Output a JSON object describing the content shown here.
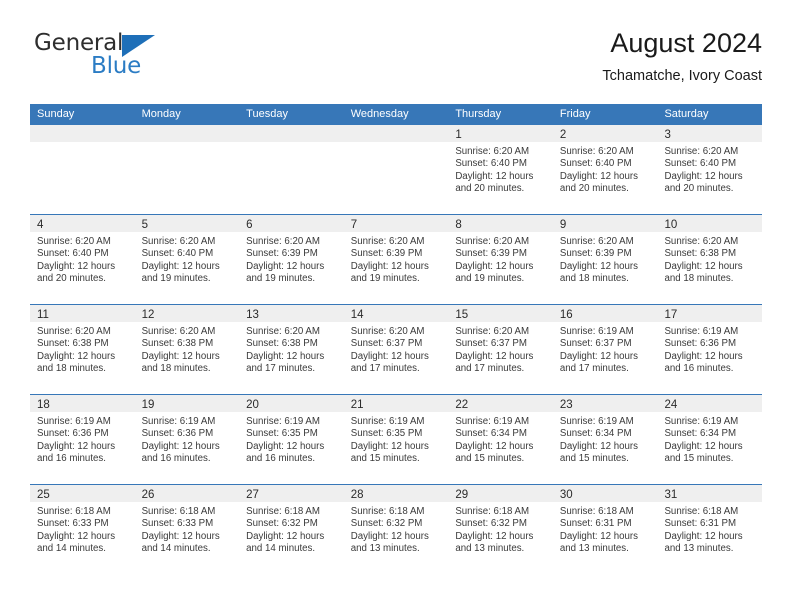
{
  "brand": {
    "name_part1": "General",
    "name_part2": "Blue",
    "triangle_icon": "triangle-icon",
    "accent_color": "#2b7cc4",
    "header_color": "#3777b8"
  },
  "header": {
    "title": "August 2024",
    "subtitle": "Tchamatche, Ivory Coast"
  },
  "weekdays": [
    "Sunday",
    "Monday",
    "Tuesday",
    "Wednesday",
    "Thursday",
    "Friday",
    "Saturday"
  ],
  "weeks": [
    [
      {
        "date": "",
        "empty": true,
        "sunrise": "",
        "sunset": "",
        "daylight_line1": "",
        "daylight_line2": ""
      },
      {
        "date": "",
        "empty": true,
        "sunrise": "",
        "sunset": "",
        "daylight_line1": "",
        "daylight_line2": ""
      },
      {
        "date": "",
        "empty": true,
        "sunrise": "",
        "sunset": "",
        "daylight_line1": "",
        "daylight_line2": ""
      },
      {
        "date": "",
        "empty": true,
        "sunrise": "",
        "sunset": "",
        "daylight_line1": "",
        "daylight_line2": ""
      },
      {
        "date": "1",
        "empty": false,
        "sunrise": "Sunrise: 6:20 AM",
        "sunset": "Sunset: 6:40 PM",
        "daylight_line1": "Daylight: 12 hours",
        "daylight_line2": "and 20 minutes."
      },
      {
        "date": "2",
        "empty": false,
        "sunrise": "Sunrise: 6:20 AM",
        "sunset": "Sunset: 6:40 PM",
        "daylight_line1": "Daylight: 12 hours",
        "daylight_line2": "and 20 minutes."
      },
      {
        "date": "3",
        "empty": false,
        "sunrise": "Sunrise: 6:20 AM",
        "sunset": "Sunset: 6:40 PM",
        "daylight_line1": "Daylight: 12 hours",
        "daylight_line2": "and 20 minutes."
      }
    ],
    [
      {
        "date": "4",
        "empty": false,
        "sunrise": "Sunrise: 6:20 AM",
        "sunset": "Sunset: 6:40 PM",
        "daylight_line1": "Daylight: 12 hours",
        "daylight_line2": "and 20 minutes."
      },
      {
        "date": "5",
        "empty": false,
        "sunrise": "Sunrise: 6:20 AM",
        "sunset": "Sunset: 6:40 PM",
        "daylight_line1": "Daylight: 12 hours",
        "daylight_line2": "and 19 minutes."
      },
      {
        "date": "6",
        "empty": false,
        "sunrise": "Sunrise: 6:20 AM",
        "sunset": "Sunset: 6:39 PM",
        "daylight_line1": "Daylight: 12 hours",
        "daylight_line2": "and 19 minutes."
      },
      {
        "date": "7",
        "empty": false,
        "sunrise": "Sunrise: 6:20 AM",
        "sunset": "Sunset: 6:39 PM",
        "daylight_line1": "Daylight: 12 hours",
        "daylight_line2": "and 19 minutes."
      },
      {
        "date": "8",
        "empty": false,
        "sunrise": "Sunrise: 6:20 AM",
        "sunset": "Sunset: 6:39 PM",
        "daylight_line1": "Daylight: 12 hours",
        "daylight_line2": "and 19 minutes."
      },
      {
        "date": "9",
        "empty": false,
        "sunrise": "Sunrise: 6:20 AM",
        "sunset": "Sunset: 6:39 PM",
        "daylight_line1": "Daylight: 12 hours",
        "daylight_line2": "and 18 minutes."
      },
      {
        "date": "10",
        "empty": false,
        "sunrise": "Sunrise: 6:20 AM",
        "sunset": "Sunset: 6:38 PM",
        "daylight_line1": "Daylight: 12 hours",
        "daylight_line2": "and 18 minutes."
      }
    ],
    [
      {
        "date": "11",
        "empty": false,
        "sunrise": "Sunrise: 6:20 AM",
        "sunset": "Sunset: 6:38 PM",
        "daylight_line1": "Daylight: 12 hours",
        "daylight_line2": "and 18 minutes."
      },
      {
        "date": "12",
        "empty": false,
        "sunrise": "Sunrise: 6:20 AM",
        "sunset": "Sunset: 6:38 PM",
        "daylight_line1": "Daylight: 12 hours",
        "daylight_line2": "and 18 minutes."
      },
      {
        "date": "13",
        "empty": false,
        "sunrise": "Sunrise: 6:20 AM",
        "sunset": "Sunset: 6:38 PM",
        "daylight_line1": "Daylight: 12 hours",
        "daylight_line2": "and 17 minutes."
      },
      {
        "date": "14",
        "empty": false,
        "sunrise": "Sunrise: 6:20 AM",
        "sunset": "Sunset: 6:37 PM",
        "daylight_line1": "Daylight: 12 hours",
        "daylight_line2": "and 17 minutes."
      },
      {
        "date": "15",
        "empty": false,
        "sunrise": "Sunrise: 6:20 AM",
        "sunset": "Sunset: 6:37 PM",
        "daylight_line1": "Daylight: 12 hours",
        "daylight_line2": "and 17 minutes."
      },
      {
        "date": "16",
        "empty": false,
        "sunrise": "Sunrise: 6:19 AM",
        "sunset": "Sunset: 6:37 PM",
        "daylight_line1": "Daylight: 12 hours",
        "daylight_line2": "and 17 minutes."
      },
      {
        "date": "17",
        "empty": false,
        "sunrise": "Sunrise: 6:19 AM",
        "sunset": "Sunset: 6:36 PM",
        "daylight_line1": "Daylight: 12 hours",
        "daylight_line2": "and 16 minutes."
      }
    ],
    [
      {
        "date": "18",
        "empty": false,
        "sunrise": "Sunrise: 6:19 AM",
        "sunset": "Sunset: 6:36 PM",
        "daylight_line1": "Daylight: 12 hours",
        "daylight_line2": "and 16 minutes."
      },
      {
        "date": "19",
        "empty": false,
        "sunrise": "Sunrise: 6:19 AM",
        "sunset": "Sunset: 6:36 PM",
        "daylight_line1": "Daylight: 12 hours",
        "daylight_line2": "and 16 minutes."
      },
      {
        "date": "20",
        "empty": false,
        "sunrise": "Sunrise: 6:19 AM",
        "sunset": "Sunset: 6:35 PM",
        "daylight_line1": "Daylight: 12 hours",
        "daylight_line2": "and 16 minutes."
      },
      {
        "date": "21",
        "empty": false,
        "sunrise": "Sunrise: 6:19 AM",
        "sunset": "Sunset: 6:35 PM",
        "daylight_line1": "Daylight: 12 hours",
        "daylight_line2": "and 15 minutes."
      },
      {
        "date": "22",
        "empty": false,
        "sunrise": "Sunrise: 6:19 AM",
        "sunset": "Sunset: 6:34 PM",
        "daylight_line1": "Daylight: 12 hours",
        "daylight_line2": "and 15 minutes."
      },
      {
        "date": "23",
        "empty": false,
        "sunrise": "Sunrise: 6:19 AM",
        "sunset": "Sunset: 6:34 PM",
        "daylight_line1": "Daylight: 12 hours",
        "daylight_line2": "and 15 minutes."
      },
      {
        "date": "24",
        "empty": false,
        "sunrise": "Sunrise: 6:19 AM",
        "sunset": "Sunset: 6:34 PM",
        "daylight_line1": "Daylight: 12 hours",
        "daylight_line2": "and 15 minutes."
      }
    ],
    [
      {
        "date": "25",
        "empty": false,
        "sunrise": "Sunrise: 6:18 AM",
        "sunset": "Sunset: 6:33 PM",
        "daylight_line1": "Daylight: 12 hours",
        "daylight_line2": "and 14 minutes."
      },
      {
        "date": "26",
        "empty": false,
        "sunrise": "Sunrise: 6:18 AM",
        "sunset": "Sunset: 6:33 PM",
        "daylight_line1": "Daylight: 12 hours",
        "daylight_line2": "and 14 minutes."
      },
      {
        "date": "27",
        "empty": false,
        "sunrise": "Sunrise: 6:18 AM",
        "sunset": "Sunset: 6:32 PM",
        "daylight_line1": "Daylight: 12 hours",
        "daylight_line2": "and 14 minutes."
      },
      {
        "date": "28",
        "empty": false,
        "sunrise": "Sunrise: 6:18 AM",
        "sunset": "Sunset: 6:32 PM",
        "daylight_line1": "Daylight: 12 hours",
        "daylight_line2": "and 13 minutes."
      },
      {
        "date": "29",
        "empty": false,
        "sunrise": "Sunrise: 6:18 AM",
        "sunset": "Sunset: 6:32 PM",
        "daylight_line1": "Daylight: 12 hours",
        "daylight_line2": "and 13 minutes."
      },
      {
        "date": "30",
        "empty": false,
        "sunrise": "Sunrise: 6:18 AM",
        "sunset": "Sunset: 6:31 PM",
        "daylight_line1": "Daylight: 12 hours",
        "daylight_line2": "and 13 minutes."
      },
      {
        "date": "31",
        "empty": false,
        "sunrise": "Sunrise: 6:18 AM",
        "sunset": "Sunset: 6:31 PM",
        "daylight_line1": "Daylight: 12 hours",
        "daylight_line2": "and 13 minutes."
      }
    ]
  ]
}
